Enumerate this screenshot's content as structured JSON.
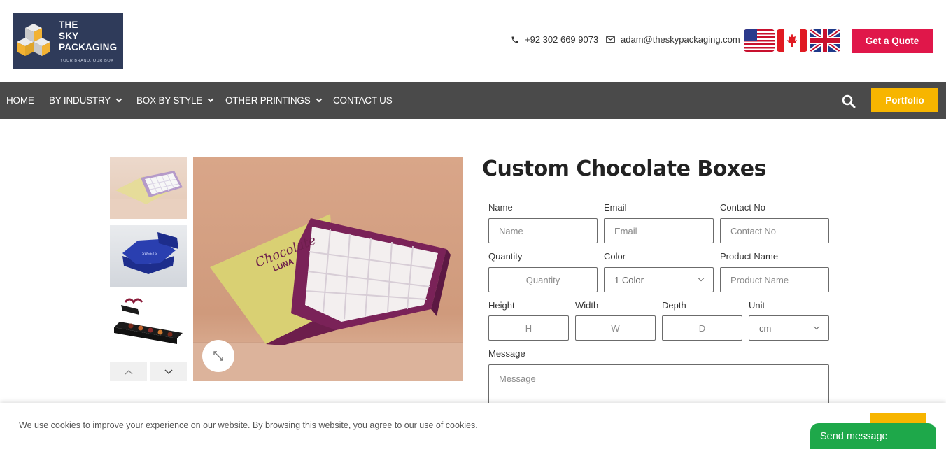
{
  "header": {
    "logo": {
      "line1": "THE",
      "line2": "SKY",
      "line3": "PACKAGING",
      "tagline": "YOUR BRAND, OUR BOX"
    },
    "phone": "+92 302 669 9073",
    "email": "adam@theskypackaging.com",
    "flags": [
      "us-flag",
      "canada-flag",
      "uk-flag"
    ],
    "quote_label": "Get a Quote"
  },
  "nav": {
    "items": [
      {
        "label": "HOME",
        "dropdown": false
      },
      {
        "label": "BY INDUSTRY",
        "dropdown": true
      },
      {
        "label": "BOX BY STYLE",
        "dropdown": true
      },
      {
        "label": "OTHER PRINTINGS",
        "dropdown": true
      },
      {
        "label": "CONTACT US",
        "dropdown": false
      }
    ],
    "portfolio_label": "Portfolio"
  },
  "product": {
    "title": "Custom Chocolate Boxes",
    "main_image_text": {
      "brand": "Chocolate",
      "name": "LUNA"
    }
  },
  "form": {
    "name": {
      "label": "Name",
      "placeholder": "Name"
    },
    "email": {
      "label": "Email",
      "placeholder": "Email"
    },
    "contact": {
      "label": "Contact No",
      "placeholder": "Contact No"
    },
    "quantity": {
      "label": "Quantity",
      "placeholder": "Quantity"
    },
    "color": {
      "label": "Color",
      "value": "1 Color"
    },
    "product_name": {
      "label": "Product Name",
      "placeholder": "Product Name"
    },
    "height": {
      "label": "Height",
      "placeholder": "H"
    },
    "width": {
      "label": "Width",
      "placeholder": "W"
    },
    "depth": {
      "label": "Depth",
      "placeholder": "D"
    },
    "unit": {
      "label": "Unit",
      "value": "cm"
    },
    "message": {
      "label": "Message",
      "placeholder": "Message"
    }
  },
  "cookie": {
    "text": "We use cookies to improve your experience on our website. By browsing this website, you agree to our use of cookies."
  },
  "chat": {
    "label": "Send message"
  },
  "colors": {
    "brand_red": "#e0174a",
    "accent_yellow": "#f7b500",
    "nav_bg": "#4a4a4a",
    "chat_green": "#1ea84a",
    "logo_bg": "#2f3b5a"
  }
}
